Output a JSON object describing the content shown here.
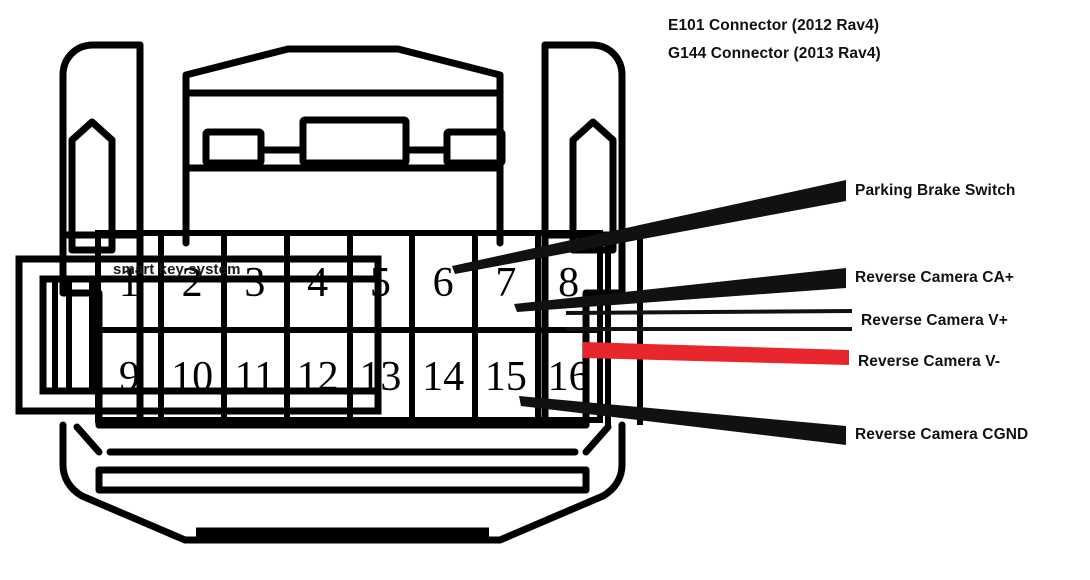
{
  "title": {
    "line_1": "E101 Connector (2012 Rav4)",
    "line_2": "G144 Connector (2013 Rav4)"
  },
  "connector": {
    "group_label": "smart key system",
    "pin_rows": [
      {
        "row": "top",
        "pins": [
          "1",
          "2",
          "3",
          "4",
          "5",
          "6",
          "7",
          "8"
        ]
      },
      {
        "row": "bottom",
        "pins": [
          "9",
          "10",
          "11",
          "12",
          "13",
          "14",
          "15",
          "16"
        ]
      }
    ]
  },
  "callouts": [
    {
      "id": "parking-brake-switch",
      "label": "Parking Brake Switch",
      "pin": "6",
      "style": "solid-black",
      "color": "#111111"
    },
    {
      "id": "reverse-camera-ca",
      "label": "Reverse Camera CA+",
      "pin": "8",
      "style": "solid-black",
      "color": "#111111"
    },
    {
      "id": "reverse-camera-vplus",
      "label": "Reverse Camera V+",
      "pin": "8",
      "style": "outline-black",
      "color": "#111111"
    },
    {
      "id": "reverse-camera-vminus",
      "label": "Reverse Camera V-",
      "pin": "16",
      "style": "solid-red",
      "color": "#E8262E"
    },
    {
      "id": "reverse-camera-cgnd",
      "label": "Reverse Camera CGND",
      "pin": "16",
      "style": "solid-black",
      "color": "#111111"
    }
  ],
  "colors": {
    "ink": "#000000",
    "label_ink": "#111111",
    "accent_red": "#E8262E",
    "background": "#FFFFFF"
  }
}
